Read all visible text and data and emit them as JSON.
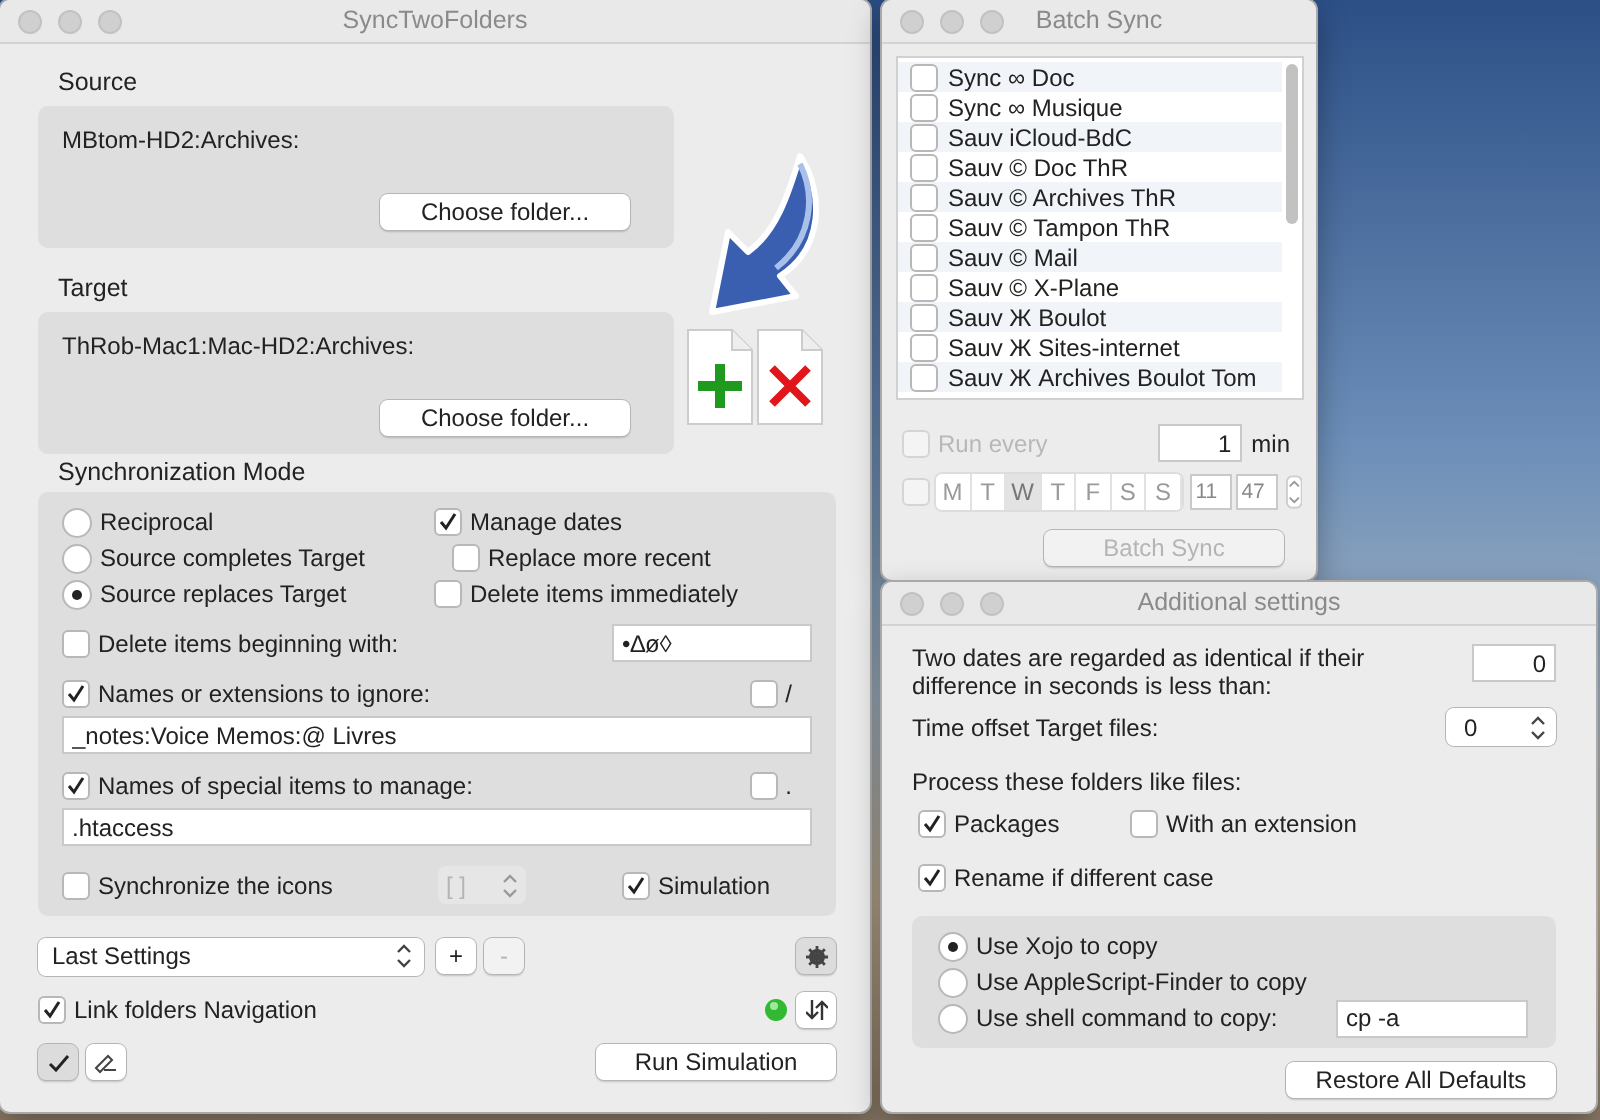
{
  "main_window": {
    "title": "SyncTwoFolders",
    "folders": [
      {
        "label": "Source",
        "path": "MBtom-HD2:Archives:",
        "button": "Choose folder..."
      },
      {
        "label": "Target",
        "path": "ThRob-Mac1:Mac-HD2:Archives:",
        "button": "Choose folder..."
      }
    ],
    "sync_mode": {
      "label": "Synchronization Mode",
      "modes": [
        {
          "label": "Reciprocal",
          "selected": false
        },
        {
          "label": "Source completes Target",
          "selected": false
        },
        {
          "label": "Source replaces Target",
          "selected": true
        }
      ],
      "options": [
        {
          "label": "Manage dates",
          "checked": true,
          "indented": false
        },
        {
          "label": "Replace more recent",
          "checked": false,
          "indented": true
        },
        {
          "label": "Delete items immediately",
          "checked": false,
          "indented": false
        }
      ],
      "delete_prefix": {
        "label": "Delete items beginning with:",
        "checked": false,
        "value": "•∆ø◊"
      },
      "lists": [
        {
          "label": "Names or extensions to ignore:",
          "checked": true,
          "flag_label": "/",
          "flag_checked": false,
          "value": "_notes:Voice Memos:@ Livres"
        },
        {
          "label": "Names of special items to manage:",
          "checked": true,
          "flag_label": ".",
          "flag_checked": false,
          "value": ".htaccess"
        }
      ],
      "sync_icons": {
        "label": "Synchronize the icons",
        "checked": false,
        "popup": "[ ]",
        "popup_disabled": true
      },
      "simulation": {
        "label": "Simulation",
        "checked": true
      }
    },
    "settings_popup": "Last Settings",
    "add_button": {
      "label": "+",
      "disabled": false
    },
    "remove_button": {
      "label": "-",
      "disabled": true
    },
    "link_navigation": {
      "label": "Link folders Navigation",
      "checked": true
    },
    "check_button": {
      "pressed": true
    },
    "edit_button": {
      "pressed": false
    },
    "run_button": "Run Simulation"
  },
  "batch_window": {
    "title": "Batch Sync",
    "items": [
      {
        "label": "Sync ∞ Doc",
        "checked": false
      },
      {
        "label": "Sync ∞ Musique",
        "checked": false
      },
      {
        "label": "Sauv iCloud-BdC",
        "checked": false
      },
      {
        "label": "Sauv © Doc ThR",
        "checked": false
      },
      {
        "label": "Sauv © Archives ThR",
        "checked": false
      },
      {
        "label": "Sauv © Tampon ThR",
        "checked": false
      },
      {
        "label": "Sauv © Mail",
        "checked": false
      },
      {
        "label": "Sauv © X-Plane",
        "checked": false
      },
      {
        "label": "Sauv Ж Boulot",
        "checked": false
      },
      {
        "label": "Sauv Ж Sites-internet",
        "checked": false
      },
      {
        "label": "Sauv Ж Archives Boulot Tom",
        "checked": false
      }
    ],
    "schedule": {
      "disabled": true,
      "run_every": {
        "label": "Run every",
        "checked": false,
        "value": "1",
        "unit": "min"
      },
      "days_checked": false,
      "days": [
        {
          "label": "M",
          "selected": false
        },
        {
          "label": "T",
          "selected": false
        },
        {
          "label": "W",
          "selected": true
        },
        {
          "label": "T",
          "selected": false
        },
        {
          "label": "F",
          "selected": false
        },
        {
          "label": "S",
          "selected": false
        },
        {
          "label": "S",
          "selected": false
        }
      ],
      "hour": "11",
      "minute": "47"
    },
    "button": {
      "label": "Batch Sync",
      "disabled": true
    }
  },
  "additional_window": {
    "title": "Additional settings",
    "tolerance": {
      "label": "Two dates are regarded as identical if their difference in seconds is less than:",
      "value": "0"
    },
    "time_offset": {
      "label": "Time offset Target files:",
      "value": "0"
    },
    "process_label": "Process these folders like files:",
    "folder_kinds": [
      {
        "label": "Packages",
        "checked": true
      },
      {
        "label": "With an extension",
        "checked": false
      }
    ],
    "rename_case": {
      "label": "Rename if different case",
      "checked": true
    },
    "copy_methods": [
      {
        "label": "Use Xojo to copy",
        "selected": true
      },
      {
        "label": "Use AppleScript-Finder to copy",
        "selected": false
      },
      {
        "label": "Use shell command to copy:",
        "selected": false
      }
    ],
    "shell_command": "cp -a",
    "restore_button": "Restore All Defaults"
  }
}
